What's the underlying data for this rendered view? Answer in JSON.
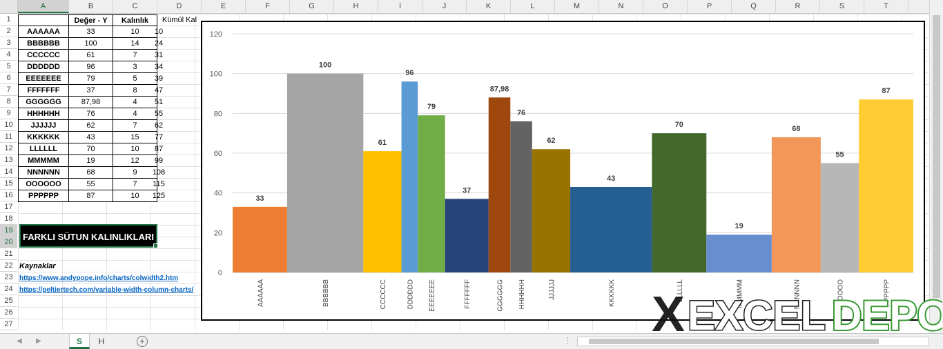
{
  "columns": [
    "A",
    "B",
    "C",
    "D",
    "E",
    "F",
    "G",
    "H",
    "I",
    "J",
    "K",
    "L",
    "M",
    "N",
    "O",
    "P",
    "Q",
    "R",
    "S",
    "T"
  ],
  "rows": [
    1,
    2,
    3,
    4,
    5,
    6,
    7,
    8,
    9,
    10,
    11,
    12,
    13,
    14,
    15,
    16,
    17,
    18,
    19,
    20,
    21,
    22,
    23,
    24,
    25,
    26,
    27
  ],
  "table": {
    "headers": [
      "",
      "Değer - Y",
      "Kalınlık",
      "Kümül Kal"
    ],
    "records": [
      {
        "name": "AAAAAA",
        "value": "33",
        "width": "10",
        "cum": "10"
      },
      {
        "name": "BBBBBB",
        "value": "100",
        "width": "14",
        "cum": "24"
      },
      {
        "name": "CCCCCC",
        "value": "61",
        "width": "7",
        "cum": "31"
      },
      {
        "name": "DDDDDD",
        "value": "96",
        "width": "3",
        "cum": "34"
      },
      {
        "name": "EEEEEEE",
        "value": "79",
        "width": "5",
        "cum": "39"
      },
      {
        "name": "FFFFFFF",
        "value": "37",
        "width": "8",
        "cum": "47"
      },
      {
        "name": "GGGGGG",
        "value": "87,98",
        "width": "4",
        "cum": "51"
      },
      {
        "name": "HHHHHH",
        "value": "76",
        "width": "4",
        "cum": "55"
      },
      {
        "name": "JJJJJJ",
        "value": "62",
        "width": "7",
        "cum": "62"
      },
      {
        "name": "KKKKKK",
        "value": "43",
        "width": "15",
        "cum": "77"
      },
      {
        "name": "LLLLLL",
        "value": "70",
        "width": "10",
        "cum": "87"
      },
      {
        "name": "MMMMM",
        "value": "19",
        "width": "12",
        "cum": "99"
      },
      {
        "name": "NNNNNN",
        "value": "68",
        "width": "9",
        "cum": "108"
      },
      {
        "name": "OOOOOO",
        "value": "55",
        "width": "7",
        "cum": "115"
      },
      {
        "name": "PPPPPP",
        "value": "87",
        "width": "10",
        "cum": "125"
      }
    ]
  },
  "title_box": "FARKLI SÜTUN KALINLIKLARI",
  "sources": {
    "heading": "Kaynaklar",
    "links": [
      "https://www.andypope.info/charts/colwidth2.htm",
      "https://peltiertech.com/variable-width-column-charts/"
    ]
  },
  "sheet_tabs": [
    "S",
    "H"
  ],
  "add_sheet_icon": "plus-circle-icon",
  "watermark": "XEXCELDEPO",
  "chart_data": {
    "type": "bar",
    "variable_width": true,
    "categories": [
      "AAAAAA",
      "BBBBBB",
      "CCCCCC",
      "DDDDDD",
      "EEEEEEE",
      "FFFFFFF",
      "GGGGGG",
      "HHHHHH",
      "JJJJJJ",
      "KKKKKK",
      "LLLLLL",
      "MMMMM",
      "NNNNNN",
      "OOOOOO",
      "PPPPPP"
    ],
    "values": [
      33,
      100,
      61,
      96,
      79,
      37,
      87.98,
      76,
      62,
      43,
      70,
      19,
      68,
      55,
      87
    ],
    "value_labels": [
      "33",
      "100",
      "61",
      "96",
      "79",
      "37",
      "87,98",
      "76",
      "62",
      "43",
      "70",
      "19",
      "68",
      "55",
      "87"
    ],
    "widths": [
      10,
      14,
      7,
      3,
      5,
      8,
      4,
      4,
      7,
      15,
      10,
      12,
      9,
      7,
      10
    ],
    "colors": [
      "#ed7d31",
      "#a5a5a5",
      "#ffc000",
      "#5b9bd5",
      "#70ad47",
      "#264478",
      "#9e480e",
      "#636363",
      "#997300",
      "#255e91",
      "#43682b",
      "#698ed0",
      "#f1975a",
      "#b7b7b7",
      "#ffcd33"
    ],
    "ylim": [
      0,
      120
    ],
    "yticks": [
      0,
      20,
      40,
      60,
      80,
      100,
      120
    ],
    "grid": true
  }
}
